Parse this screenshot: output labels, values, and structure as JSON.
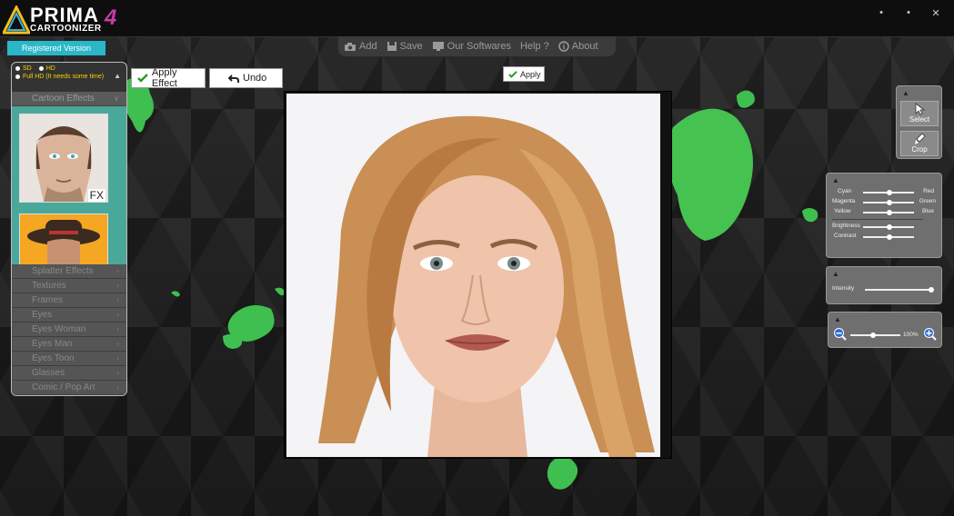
{
  "titlebar": {
    "logo_main": "PRIMA",
    "logo_sub": "CARTOONIZER",
    "logo_num": "4",
    "minimize": "•",
    "maximize": "•",
    "close": "✕"
  },
  "registered": "Registered Version",
  "topmenu": {
    "add": "Add",
    "save": "Save",
    "softwares": "Our Softwares",
    "help": "Help ?",
    "about": "About"
  },
  "left_panel": {
    "sd": "SD",
    "hd": "HD",
    "fullhd": "Full HD (It needs some time)",
    "cartoon_effects": "Cartoon Effects",
    "fx_label": "FX",
    "items": [
      "Splatter Effects",
      "Textures",
      "Frames",
      "Eyes",
      "Eyes Woman",
      "Eyes Man",
      "Eyes Toon",
      "Glasses",
      "Comic / Pop Art"
    ]
  },
  "toolbar": {
    "apply_effect": "Apply Effect",
    "undo": "Undo",
    "apply": "Apply"
  },
  "right_panel": {
    "select": "Select",
    "crop": "Crop",
    "color": {
      "cyan": "Cyan",
      "red": "Red",
      "magenta": "Magenta",
      "green": "Green",
      "yellow": "Yellow",
      "blue": "Blue",
      "brightness": "Brightness",
      "contrast": "Contrast"
    },
    "intensity": "Intensity",
    "zoom_value": "100%"
  },
  "colors": {
    "accent_cyan": "#2ab8c8",
    "effects_bg": "#4aa89a",
    "splash_green": "#3fbf4f"
  }
}
